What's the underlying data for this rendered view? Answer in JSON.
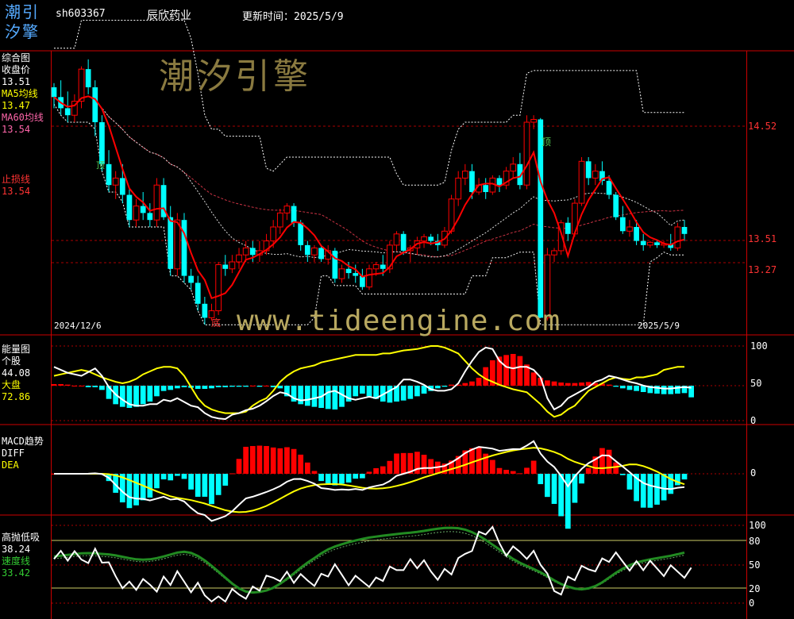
{
  "header": {
    "logo_top": "潮引",
    "logo_bottom": "汐擎",
    "code": "sh603367",
    "name": "辰欣药业",
    "update_label": "更新时间：2025/5/9"
  },
  "watermark_main": "潮汐引擎",
  "watermark_url": "www.tideengine.com",
  "colors": {
    "background": "#000000",
    "rise": "#ff0000",
    "fall": "#00ffff",
    "ma5": "#ffff00",
    "ma60": "#ff66aa",
    "divider": "#ff0000",
    "speed_line": "#228b22"
  },
  "main_panel": {
    "title": "综合图",
    "close_label": "收盘价",
    "close_value": "13.51",
    "ma5_label": "MA5均线",
    "ma5_value": "13.47",
    "ma60_label": "MA60均线",
    "ma60_value": "13.54",
    "stop_label": "止损线",
    "stop_value": "13.54",
    "axis_labels": [
      "14.52",
      "13.51",
      "13.27"
    ],
    "date_start": "2024/12/6",
    "date_end": "2025/5/9",
    "top_marker": "顶",
    "bottom_marker": "底",
    "small_marker": "顶"
  },
  "energy_panel": {
    "title": "能量图",
    "stock_label": "个股",
    "stock_value": "44.08",
    "market_label": "大盘",
    "market_value": "72.86",
    "axis_labels": [
      "100",
      "50",
      "0"
    ]
  },
  "macd_panel": {
    "title": "MACD趋势",
    "diff_label": "DIFF",
    "dea_label": "DEA",
    "axis_labels": [
      "0"
    ]
  },
  "sell_panel": {
    "title": "高抛低吸",
    "value": "38.24",
    "speed_label": "速度线",
    "speed_value": "33.42",
    "axis_labels": [
      "100",
      "80",
      "50",
      "20",
      "0"
    ]
  },
  "chart_data": {
    "type": "candlestick",
    "price_scale": [
      12.8,
      14.8
    ],
    "start_date": "2024/12/6",
    "end_date": "2025/5/9",
    "candles": [
      [
        14.55,
        14.58,
        14.4,
        14.48
      ],
      [
        14.48,
        14.6,
        14.35,
        14.4
      ],
      [
        14.4,
        14.52,
        14.3,
        14.35
      ],
      [
        14.35,
        14.5,
        14.3,
        14.45
      ],
      [
        14.45,
        14.7,
        14.4,
        14.68
      ],
      [
        14.68,
        14.75,
        14.5,
        14.55
      ],
      [
        14.55,
        14.6,
        14.2,
        14.3
      ],
      [
        14.3,
        14.35,
        13.95,
        14.0
      ],
      [
        14.0,
        14.1,
        13.8,
        13.85
      ],
      [
        13.85,
        13.95,
        13.75,
        13.9
      ],
      [
        13.9,
        14.0,
        13.72,
        13.78
      ],
      [
        13.78,
        13.82,
        13.55,
        13.6
      ],
      [
        13.6,
        13.75,
        13.55,
        13.7
      ],
      [
        13.7,
        13.8,
        13.6,
        13.65
      ],
      [
        13.65,
        13.72,
        13.55,
        13.6
      ],
      [
        13.6,
        13.9,
        13.55,
        13.85
      ],
      [
        13.85,
        13.9,
        13.6,
        13.62
      ],
      [
        13.62,
        13.7,
        13.2,
        13.25
      ],
      [
        13.25,
        13.65,
        13.2,
        13.6
      ],
      [
        13.6,
        13.65,
        13.15,
        13.2
      ],
      [
        13.2,
        13.25,
        13.1,
        13.15
      ],
      [
        13.15,
        13.2,
        12.95,
        13.0
      ],
      [
        13.0,
        13.05,
        12.85,
        12.9
      ],
      [
        12.9,
        13.0,
        12.88,
        12.95
      ],
      [
        12.95,
        13.3,
        12.92,
        13.28
      ],
      [
        13.28,
        13.35,
        13.2,
        13.25
      ],
      [
        13.25,
        13.35,
        13.22,
        13.3
      ],
      [
        13.3,
        13.4,
        13.25,
        13.35
      ],
      [
        13.35,
        13.45,
        13.3,
        13.4
      ],
      [
        13.4,
        13.45,
        13.3,
        13.35
      ],
      [
        13.35,
        13.45,
        13.3,
        13.38
      ],
      [
        13.38,
        13.5,
        13.35,
        13.45
      ],
      [
        13.45,
        13.6,
        13.4,
        13.55
      ],
      [
        13.55,
        13.68,
        13.5,
        13.65
      ],
      [
        13.65,
        13.72,
        13.6,
        13.7
      ],
      [
        13.7,
        13.72,
        13.55,
        13.58
      ],
      [
        13.58,
        13.6,
        13.38,
        13.42
      ],
      [
        13.42,
        13.45,
        13.3,
        13.35
      ],
      [
        13.35,
        13.42,
        13.3,
        13.4
      ],
      [
        13.4,
        13.42,
        13.3,
        13.32
      ],
      [
        13.32,
        13.42,
        13.28,
        13.38
      ],
      [
        13.38,
        13.4,
        13.15,
        13.18
      ],
      [
        13.18,
        13.28,
        13.15,
        13.25
      ],
      [
        13.25,
        13.3,
        13.18,
        13.22
      ],
      [
        13.22,
        13.28,
        13.15,
        13.2
      ],
      [
        13.2,
        13.25,
        13.1,
        13.12
      ],
      [
        13.12,
        13.28,
        13.1,
        13.25
      ],
      [
        13.25,
        13.3,
        13.2,
        13.28
      ],
      [
        13.28,
        13.35,
        13.2,
        13.25
      ],
      [
        13.25,
        13.45,
        13.22,
        13.42
      ],
      [
        13.42,
        13.52,
        13.38,
        13.5
      ],
      [
        13.5,
        13.52,
        13.35,
        13.38
      ],
      [
        13.38,
        13.42,
        13.3,
        13.4
      ],
      [
        13.4,
        13.48,
        13.35,
        13.45
      ],
      [
        13.45,
        13.5,
        13.4,
        13.48
      ],
      [
        13.48,
        13.5,
        13.42,
        13.45
      ],
      [
        13.45,
        13.5,
        13.38,
        13.42
      ],
      [
        13.42,
        13.55,
        13.4,
        13.52
      ],
      [
        13.52,
        13.78,
        13.5,
        13.75
      ],
      [
        13.75,
        13.95,
        13.7,
        13.9
      ],
      [
        13.9,
        14.0,
        13.85,
        13.95
      ],
      [
        13.95,
        14.0,
        13.75,
        13.8
      ],
      [
        13.8,
        13.9,
        13.78,
        13.85
      ],
      [
        13.85,
        13.9,
        13.75,
        13.8
      ],
      [
        13.8,
        13.92,
        13.78,
        13.9
      ],
      [
        13.9,
        13.92,
        13.8,
        13.85
      ],
      [
        13.85,
        13.98,
        13.82,
        13.95
      ],
      [
        13.95,
        14.05,
        13.9,
        14.0
      ],
      [
        14.0,
        14.08,
        13.82,
        13.85
      ],
      [
        13.85,
        14.35,
        13.82,
        14.3
      ],
      [
        14.3,
        14.35,
        14.25,
        14.32
      ],
      [
        14.32,
        14.33,
        12.9,
        12.9
      ],
      [
        12.9,
        13.4,
        12.88,
        13.35
      ],
      [
        13.35,
        13.4,
        13.3,
        13.38
      ],
      [
        13.38,
        13.6,
        13.35,
        13.58
      ],
      [
        13.58,
        13.62,
        13.45,
        13.5
      ],
      [
        13.5,
        13.75,
        13.48,
        13.72
      ],
      [
        13.72,
        14.05,
        13.7,
        14.02
      ],
      [
        14.02,
        14.05,
        13.85,
        13.9
      ],
      [
        13.9,
        14.0,
        13.85,
        13.95
      ],
      [
        13.95,
        14.02,
        13.85,
        13.88
      ],
      [
        13.88,
        13.92,
        13.75,
        13.78
      ],
      [
        13.78,
        13.8,
        13.6,
        13.62
      ],
      [
        13.62,
        13.7,
        13.5,
        13.52
      ],
      [
        13.52,
        13.6,
        13.48,
        13.55
      ],
      [
        13.55,
        13.6,
        13.42,
        13.45
      ],
      [
        13.45,
        13.5,
        13.38,
        13.42
      ],
      [
        13.42,
        13.45,
        13.4,
        13.44
      ],
      [
        13.44,
        13.46,
        13.4,
        13.42
      ],
      [
        13.42,
        13.45,
        13.4,
        13.43
      ],
      [
        13.43,
        13.5,
        13.38,
        13.4
      ],
      [
        13.4,
        13.58,
        13.38,
        13.55
      ],
      [
        13.55,
        13.6,
        13.45,
        13.5
      ]
    ],
    "energy_stock": [
      72,
      68,
      64,
      62,
      60,
      65,
      70,
      60,
      45,
      35,
      28,
      22,
      20,
      20,
      22,
      22,
      28,
      26,
      30,
      25,
      20,
      18,
      10,
      5,
      3,
      2,
      8,
      10,
      14,
      16,
      20,
      26,
      33,
      38,
      36,
      30,
      27,
      28,
      30,
      32,
      38,
      40,
      35,
      30,
      28,
      30,
      32,
      30,
      35,
      40,
      45,
      55,
      55,
      52,
      48,
      42,
      40,
      40,
      42,
      50,
      66,
      80,
      92,
      98,
      96,
      80,
      72,
      70,
      72,
      72,
      68,
      58,
      30,
      15,
      20,
      30,
      35,
      40,
      45,
      52,
      55,
      60,
      58,
      55,
      52,
      50,
      47,
      45,
      44,
      43,
      43,
      44,
      45,
      44
    ],
    "energy_market": [
      60,
      62,
      64,
      66,
      68,
      66,
      62,
      58,
      55,
      52,
      50,
      52,
      56,
      62,
      66,
      70,
      72,
      72,
      70,
      60,
      45,
      30,
      20,
      15,
      12,
      10,
      10,
      10,
      12,
      20,
      26,
      30,
      40,
      52,
      60,
      66,
      70,
      72,
      74,
      78,
      80,
      82,
      84,
      86,
      88,
      88,
      88,
      88,
      90,
      90,
      92,
      94,
      95,
      96,
      98,
      100,
      100,
      98,
      94,
      90,
      80,
      70,
      62,
      56,
      52,
      48,
      45,
      42,
      40,
      38,
      30,
      22,
      12,
      5,
      8,
      15,
      20,
      30,
      40,
      45,
      50,
      55,
      58,
      56,
      55,
      58,
      58,
      60,
      62,
      68,
      70,
      72,
      72
    ],
    "energy_bars": [
      3,
      3,
      2,
      0,
      0,
      -3,
      -3,
      -8,
      -25,
      -35,
      -40,
      -42,
      -40,
      -35,
      -30,
      -20,
      -10,
      -8,
      -5,
      -3,
      -4,
      -6,
      -6,
      -5,
      -3,
      -3,
      -2,
      -2,
      -2,
      0,
      -2,
      0,
      -3,
      -5,
      -20,
      -30,
      -35,
      -38,
      -40,
      -42,
      -44,
      -45,
      -40,
      -30,
      -20,
      -15,
      -20,
      -25,
      -30,
      -32,
      -30,
      -28,
      -25,
      -20,
      -15,
      -10,
      -5,
      -2,
      2,
      2,
      5,
      8,
      15,
      35,
      48,
      55,
      58,
      60,
      56,
      40,
      25,
      15,
      10,
      8,
      6,
      5,
      5,
      6,
      7,
      5,
      4,
      2,
      -2,
      -5,
      -8,
      -10,
      -12,
      -14,
      -15,
      -16,
      -16,
      -15,
      -14,
      -22
    ]
  }
}
